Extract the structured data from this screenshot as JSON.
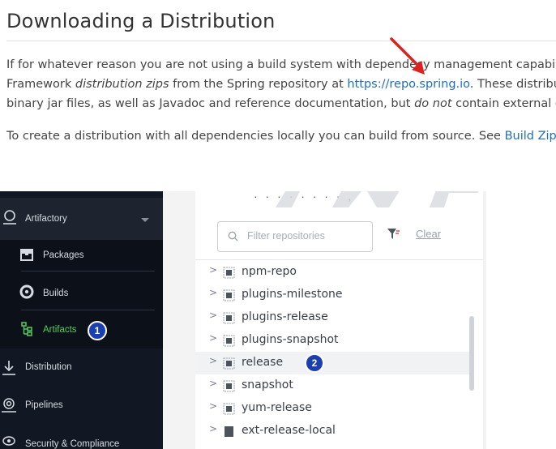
{
  "doc": {
    "title": "Downloading a Distribution",
    "para1_line1": "If for whatever reason you are not using a build system with dependeсy management capabil",
    "para1_line2_a": "Framework ",
    "para1_line2_em": "distribution zips",
    "para1_line2_b": " from the Spring repository at ",
    "para1_link": "https://repo.spring.io",
    "para1_line2_c": ". These distribut",
    "para1_line3_a": "binary jar files, as well as Javadoc and reference documentation, but ",
    "para1_line3_em": "do not",
    "para1_line3_b": " contain external de",
    "para2_a": "To create a distribution with all dependencies locally you can build from source. See ",
    "para2_link": "Build Zip w"
  },
  "sidebar": {
    "top_label": "Artifactory",
    "items": [
      {
        "label": "Packages",
        "icon": "packages-icon"
      },
      {
        "label": "Builds",
        "icon": "builds-icon"
      },
      {
        "label": "Artifacts",
        "icon": "artifacts-icon",
        "badge": "1"
      }
    ],
    "sections": [
      {
        "label": "Distribution",
        "icon": "distribution-icon"
      },
      {
        "label": "Pipelines",
        "icon": "pipelines-icon"
      },
      {
        "label": "Security & Compliance",
        "icon": "security-icon"
      }
    ]
  },
  "panel": {
    "partial_text": "· · · · · · · · ,",
    "filter_placeholder": "Filter repositories",
    "clear_label": "Clear",
    "repos": [
      {
        "name": "npm-repo",
        "type": "virtual"
      },
      {
        "name": "plugins-milestone",
        "type": "virtual"
      },
      {
        "name": "plugins-release",
        "type": "virtual"
      },
      {
        "name": "plugins-snapshot",
        "type": "virtual"
      },
      {
        "name": "release",
        "type": "virtual",
        "badge": "2"
      },
      {
        "name": "snapshot",
        "type": "virtual"
      },
      {
        "name": "yum-release",
        "type": "virtual"
      },
      {
        "name": "ext-release-local",
        "type": "local"
      }
    ]
  },
  "colors": {
    "accent_active": "#4fd05a",
    "badge": "#1a3fb0",
    "link": "#1e6fb8",
    "arrow": "#e02020"
  }
}
